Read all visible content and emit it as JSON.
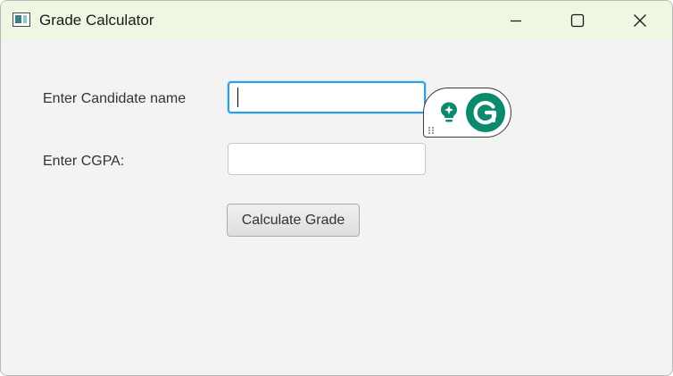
{
  "window": {
    "title": "Grade Calculator",
    "controls": [
      "minimize",
      "maximize",
      "close"
    ]
  },
  "form": {
    "name_label": "Enter Candidate name",
    "name_value": "",
    "cgpa_label": "Enter CGPA:",
    "cgpa_value": "",
    "submit_label": "Calculate Grade"
  },
  "overlay": {
    "widget": "Grammarly",
    "icons": [
      "lightbulb-icon",
      "grammarly-logo-icon",
      "drag-handle-icon"
    ]
  },
  "colors": {
    "titlebar_bg": "#eef7e2",
    "window_bg": "#f3f3f3",
    "focus_border": "#2a9fe0",
    "grammarly_green": "#0b8a70"
  }
}
